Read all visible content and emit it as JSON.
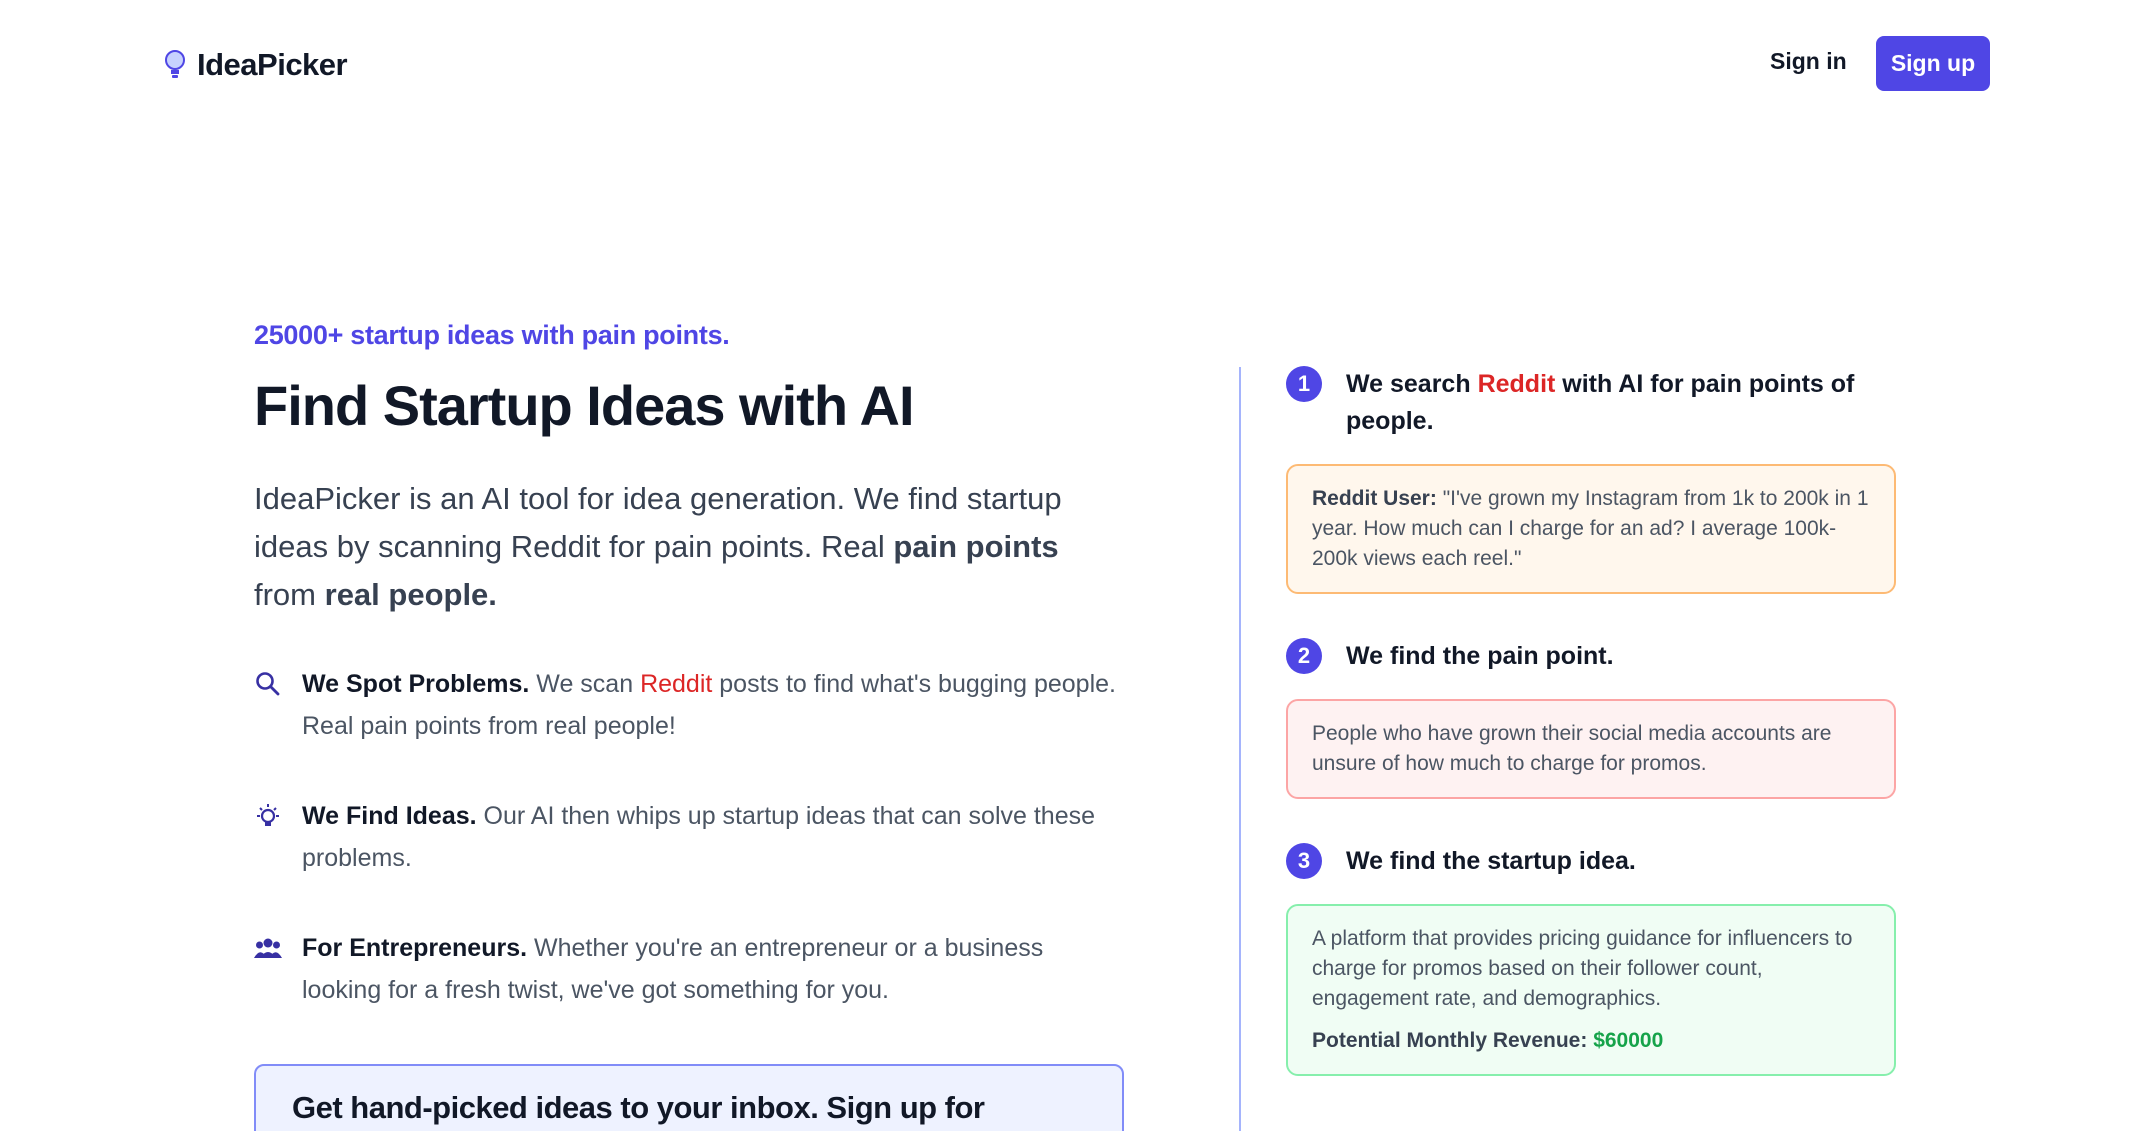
{
  "header": {
    "brand": "IdeaPicker",
    "signin_label": "Sign in",
    "signup_label": "Sign up"
  },
  "hero": {
    "eyebrow": "25000+ startup ideas with pain points.",
    "title": "Find Startup Ideas with AI",
    "lead_part1": "IdeaPicker is an AI tool for idea generation. We find startup ideas by scanning Reddit for pain points. Real ",
    "lead_bold1": "pain points",
    "lead_part2": " from ",
    "lead_bold2": "real people."
  },
  "features": [
    {
      "icon": "search-icon",
      "title": "We Spot Problems.",
      "text_before": " We scan ",
      "highlight": "Reddit",
      "text_after": " posts to find what's bugging people. Real pain points from real people!"
    },
    {
      "icon": "lightbulb-icon",
      "title": "We Find Ideas.",
      "text": " Our AI then whips up startup ideas that can solve these problems."
    },
    {
      "icon": "users-icon",
      "title": "For Entrepreneurs.",
      "text": " Whether you're an entrepreneur or a business looking for a fresh twist, we've got something for you."
    }
  ],
  "cta": {
    "text": "Get hand-picked ideas to your inbox. Sign up for"
  },
  "steps": [
    {
      "num": "1",
      "title_before": "We search ",
      "title_highlight": "Reddit",
      "title_after": " with AI for pain points of people.",
      "card_label": "Reddit User:",
      "card_text": " \"I've grown my Instagram from 1k to 200k in 1 year. How much can I charge for an ad? I average 100k-200k views each reel.\""
    },
    {
      "num": "2",
      "title": "We find the pain point.",
      "card_text": "People who have grown their social media accounts are unsure of how much to charge for promos."
    },
    {
      "num": "3",
      "title": "We find the startup idea.",
      "card_text": "A platform that provides pricing guidance for influencers to charge for promos based on their follower count, engagement rate, and demographics.",
      "revenue_label": "Potential Monthly Revenue:",
      "revenue_value": "$60000"
    }
  ],
  "colors": {
    "brand": "#4f46e5",
    "reddit": "#dc2626",
    "money": "#16a34a"
  }
}
